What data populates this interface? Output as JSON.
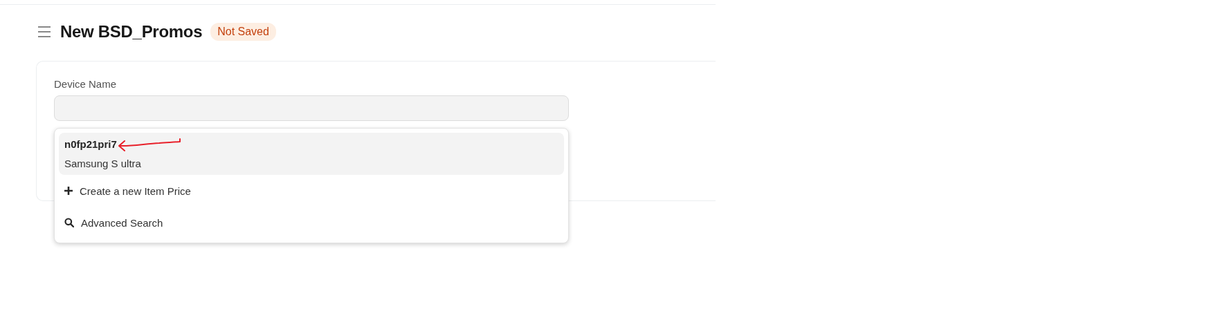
{
  "header": {
    "title": "New BSD_Promos",
    "status": "Not Saved"
  },
  "form": {
    "field": {
      "label": "Device Name"
    },
    "dropdown": [
      {
        "kind": "result",
        "title": "n0fp21pri7",
        "subtitle": "Samsung S ultra",
        "selected": true,
        "annotated": true
      },
      {
        "kind": "create",
        "label": "Create a new Item Price",
        "selected": false
      },
      {
        "kind": "search",
        "label": "Advanced Search",
        "selected": false
      }
    ]
  }
}
